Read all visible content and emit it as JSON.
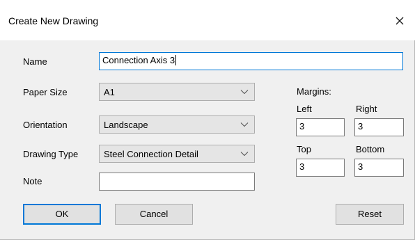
{
  "dialog": {
    "title": "Create New Drawing",
    "close_icon": "close-icon"
  },
  "form": {
    "name_label": "Name",
    "name_value": "Connection Axis 3",
    "paper_size_label": "Paper Size",
    "paper_size_value": "A1",
    "orientation_label": "Orientation",
    "orientation_value": "Landscape",
    "drawing_type_label": "Drawing Type",
    "drawing_type_value": "Steel Connection Detail",
    "note_label": "Note",
    "note_value": ""
  },
  "margins": {
    "heading": "Margins:",
    "left_label": "Left",
    "left_value": "3",
    "right_label": "Right",
    "right_value": "3",
    "top_label": "Top",
    "top_value": "3",
    "bottom_label": "Bottom",
    "bottom_value": "3"
  },
  "buttons": {
    "ok_label": "OK",
    "cancel_label": "Cancel",
    "reset_label": "Reset"
  },
  "colors": {
    "dialog_background": "#f0f0f0",
    "titlebar_background": "#ffffff",
    "focus_accent": "#0078d7"
  }
}
